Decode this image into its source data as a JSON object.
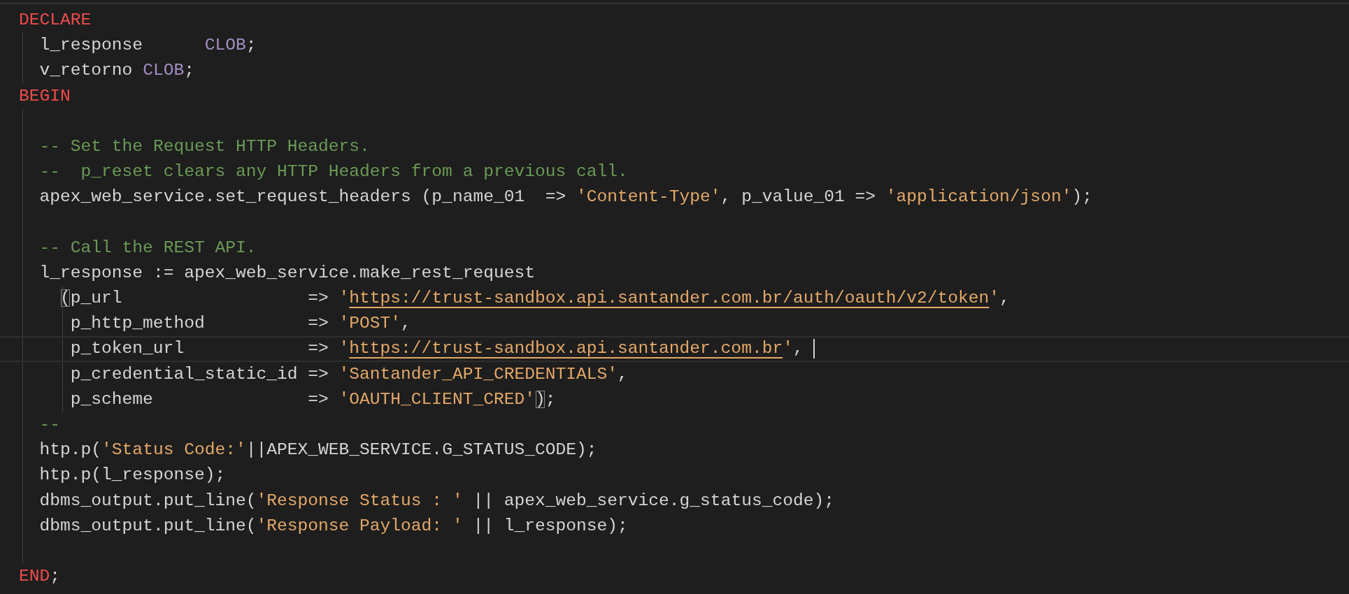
{
  "editor": {
    "lines": [
      {
        "kind": "code",
        "current": false,
        "tokens": [
          {
            "kind": "keyword",
            "text": "DECLARE"
          }
        ]
      },
      {
        "kind": "code",
        "current": false,
        "tokens": [
          {
            "kind": "plain",
            "text": "  l_response      "
          },
          {
            "kind": "type",
            "text": "CLOB"
          },
          {
            "kind": "plain",
            "text": ";"
          }
        ]
      },
      {
        "kind": "code",
        "current": false,
        "tokens": [
          {
            "kind": "plain",
            "text": "  v_retorno "
          },
          {
            "kind": "type",
            "text": "CLOB"
          },
          {
            "kind": "plain",
            "text": ";"
          }
        ]
      },
      {
        "kind": "code",
        "current": false,
        "tokens": [
          {
            "kind": "keyword",
            "text": "BEGIN"
          }
        ]
      },
      {
        "kind": "blank"
      },
      {
        "kind": "code",
        "current": false,
        "tokens": [
          {
            "kind": "comment",
            "text": "  -- Set the Request HTTP Headers."
          }
        ]
      },
      {
        "kind": "code",
        "current": false,
        "tokens": [
          {
            "kind": "comment",
            "text": "  --  p_reset clears any HTTP Headers from a previous call."
          }
        ]
      },
      {
        "kind": "code",
        "current": false,
        "tokens": [
          {
            "kind": "plain",
            "text": "  apex_web_service.set_request_headers (p_name_01  => "
          },
          {
            "kind": "string",
            "text": "'Content-Type'"
          },
          {
            "kind": "plain",
            "text": ", p_value_01 => "
          },
          {
            "kind": "string",
            "text": "'application/json'"
          },
          {
            "kind": "plain",
            "text": ");"
          }
        ]
      },
      {
        "kind": "blank"
      },
      {
        "kind": "code",
        "current": false,
        "tokens": [
          {
            "kind": "comment",
            "text": "  -- Call the REST API."
          }
        ]
      },
      {
        "kind": "code",
        "current": false,
        "tokens": [
          {
            "kind": "plain",
            "text": "  l_response := apex_web_service.make_rest_request"
          }
        ]
      },
      {
        "kind": "code",
        "current": false,
        "tokens": [
          {
            "kind": "bracket",
            "text": "    ("
          },
          {
            "kind": "plain",
            "text": "p_url                  => "
          },
          {
            "kind": "string",
            "text": "'"
          },
          {
            "kind": "link",
            "text": "https://trust-sandbox.api.santander.com.br/auth/oauth/v2/token"
          },
          {
            "kind": "string",
            "text": "'"
          },
          {
            "kind": "plain",
            "text": ","
          }
        ]
      },
      {
        "kind": "code",
        "current": false,
        "tokens": [
          {
            "kind": "plain",
            "text": "     p_http_method          => "
          },
          {
            "kind": "string",
            "text": "'POST'"
          },
          {
            "kind": "plain",
            "text": ","
          }
        ]
      },
      {
        "kind": "code",
        "current": true,
        "tokens": [
          {
            "kind": "plain",
            "text": "     p_token_url            => "
          },
          {
            "kind": "string",
            "text": "'"
          },
          {
            "kind": "link",
            "text": "https://trust-sandbox.api.santander.com.br"
          },
          {
            "kind": "string",
            "text": "'"
          },
          {
            "kind": "plain",
            "text": ", "
          }
        ]
      },
      {
        "kind": "code",
        "current": false,
        "tokens": [
          {
            "kind": "plain",
            "text": "     p_credential_static_id => "
          },
          {
            "kind": "string",
            "text": "'Santander_API_CREDENTIALS'"
          },
          {
            "kind": "plain",
            "text": ","
          }
        ]
      },
      {
        "kind": "code",
        "current": false,
        "tokens": [
          {
            "kind": "plain",
            "text": "     p_scheme               => "
          },
          {
            "kind": "string",
            "text": "'OAUTH_CLIENT_CRED'"
          },
          {
            "kind": "bracket",
            "text": ")"
          },
          {
            "kind": "plain",
            "text": ";"
          }
        ]
      },
      {
        "kind": "code",
        "current": false,
        "tokens": [
          {
            "kind": "comment",
            "text": "  --"
          }
        ]
      },
      {
        "kind": "code",
        "current": false,
        "tokens": [
          {
            "kind": "plain",
            "text": "  htp.p("
          },
          {
            "kind": "string",
            "text": "'Status Code:'"
          },
          {
            "kind": "plain",
            "text": "||APEX_WEB_SERVICE.G_STATUS_CODE);"
          }
        ]
      },
      {
        "kind": "code",
        "current": false,
        "tokens": [
          {
            "kind": "plain",
            "text": "  htp.p(l_response);"
          }
        ]
      },
      {
        "kind": "code",
        "current": false,
        "tokens": [
          {
            "kind": "plain",
            "text": "  dbms_output.put_line("
          },
          {
            "kind": "string",
            "text": "'Response Status : '"
          },
          {
            "kind": "plain",
            "text": " || apex_web_service.g_status_code);"
          }
        ]
      },
      {
        "kind": "code",
        "current": false,
        "tokens": [
          {
            "kind": "plain",
            "text": "  dbms_output.put_line("
          },
          {
            "kind": "string",
            "text": "'Response Payload: '"
          },
          {
            "kind": "plain",
            "text": " || l_response);"
          }
        ]
      },
      {
        "kind": "blank"
      },
      {
        "kind": "code",
        "current": false,
        "tokens": [
          {
            "kind": "keyword",
            "text": "END"
          },
          {
            "kind": "plain",
            "text": ";"
          }
        ]
      }
    ]
  }
}
